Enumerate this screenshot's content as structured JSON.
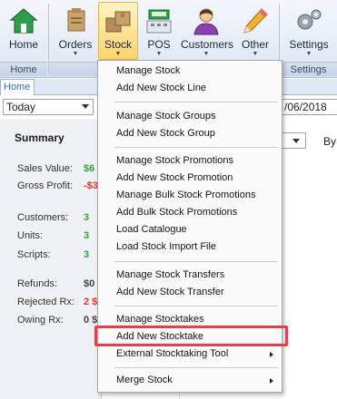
{
  "ribbon": {
    "groups": [
      {
        "label": "Home"
      },
      {
        "label": ""
      },
      {
        "label": "Settings"
      }
    ],
    "buttons": {
      "home": "Home",
      "orders": "Orders",
      "stock": "Stock",
      "pos": "POS",
      "customers": "Customers",
      "other": "Other",
      "settings": "Settings"
    },
    "dropdown_glyph": "▼"
  },
  "tabs": {
    "home": "Home"
  },
  "filter": {
    "period": "Today",
    "date_partial": "/06/2018"
  },
  "summary": {
    "title": "Summary",
    "rows": [
      {
        "label": "Sales Value:",
        "value": "$6"
      },
      {
        "label": "Gross Profit:",
        "value": "-$3"
      },
      {
        "label": "Customers:",
        "value": "3"
      },
      {
        "label": "Units:",
        "value": "3"
      },
      {
        "label": "Scripts:",
        "value": "3"
      },
      {
        "label": "Refunds:",
        "value": "$0"
      },
      {
        "label": "Rejected Rx:",
        "value": "2 $"
      },
      {
        "label": "Owing Rx:",
        "value": "0 $"
      }
    ],
    "by_label": "By"
  },
  "stock_menu": {
    "items": [
      "Manage Stock",
      "Add New Stock Line",
      "Manage Stock Groups",
      "Add New Stock Group",
      "Manage Stock Promotions",
      "Add New Stock Promotion",
      "Manage Bulk Stock Promotions",
      "Add Bulk Stock Promotions",
      "Load Catalogue",
      "Load Stock Import File",
      "Manage Stock Transfers",
      "Add New Stock Transfer",
      "Manage Stocktakes",
      "Add New Stocktake",
      "External Stocktaking Tool",
      "Merge Stock"
    ]
  },
  "colors": {
    "highlight_box": "#e0404a",
    "positive_value": "#39a33a",
    "negative_value": "#e03a2a",
    "active_button": "#ffd66b"
  },
  "icons": [
    "home-icon",
    "orders-icon",
    "stock-icon",
    "pos-icon",
    "customers-icon",
    "other-icon",
    "settings-icon"
  ]
}
